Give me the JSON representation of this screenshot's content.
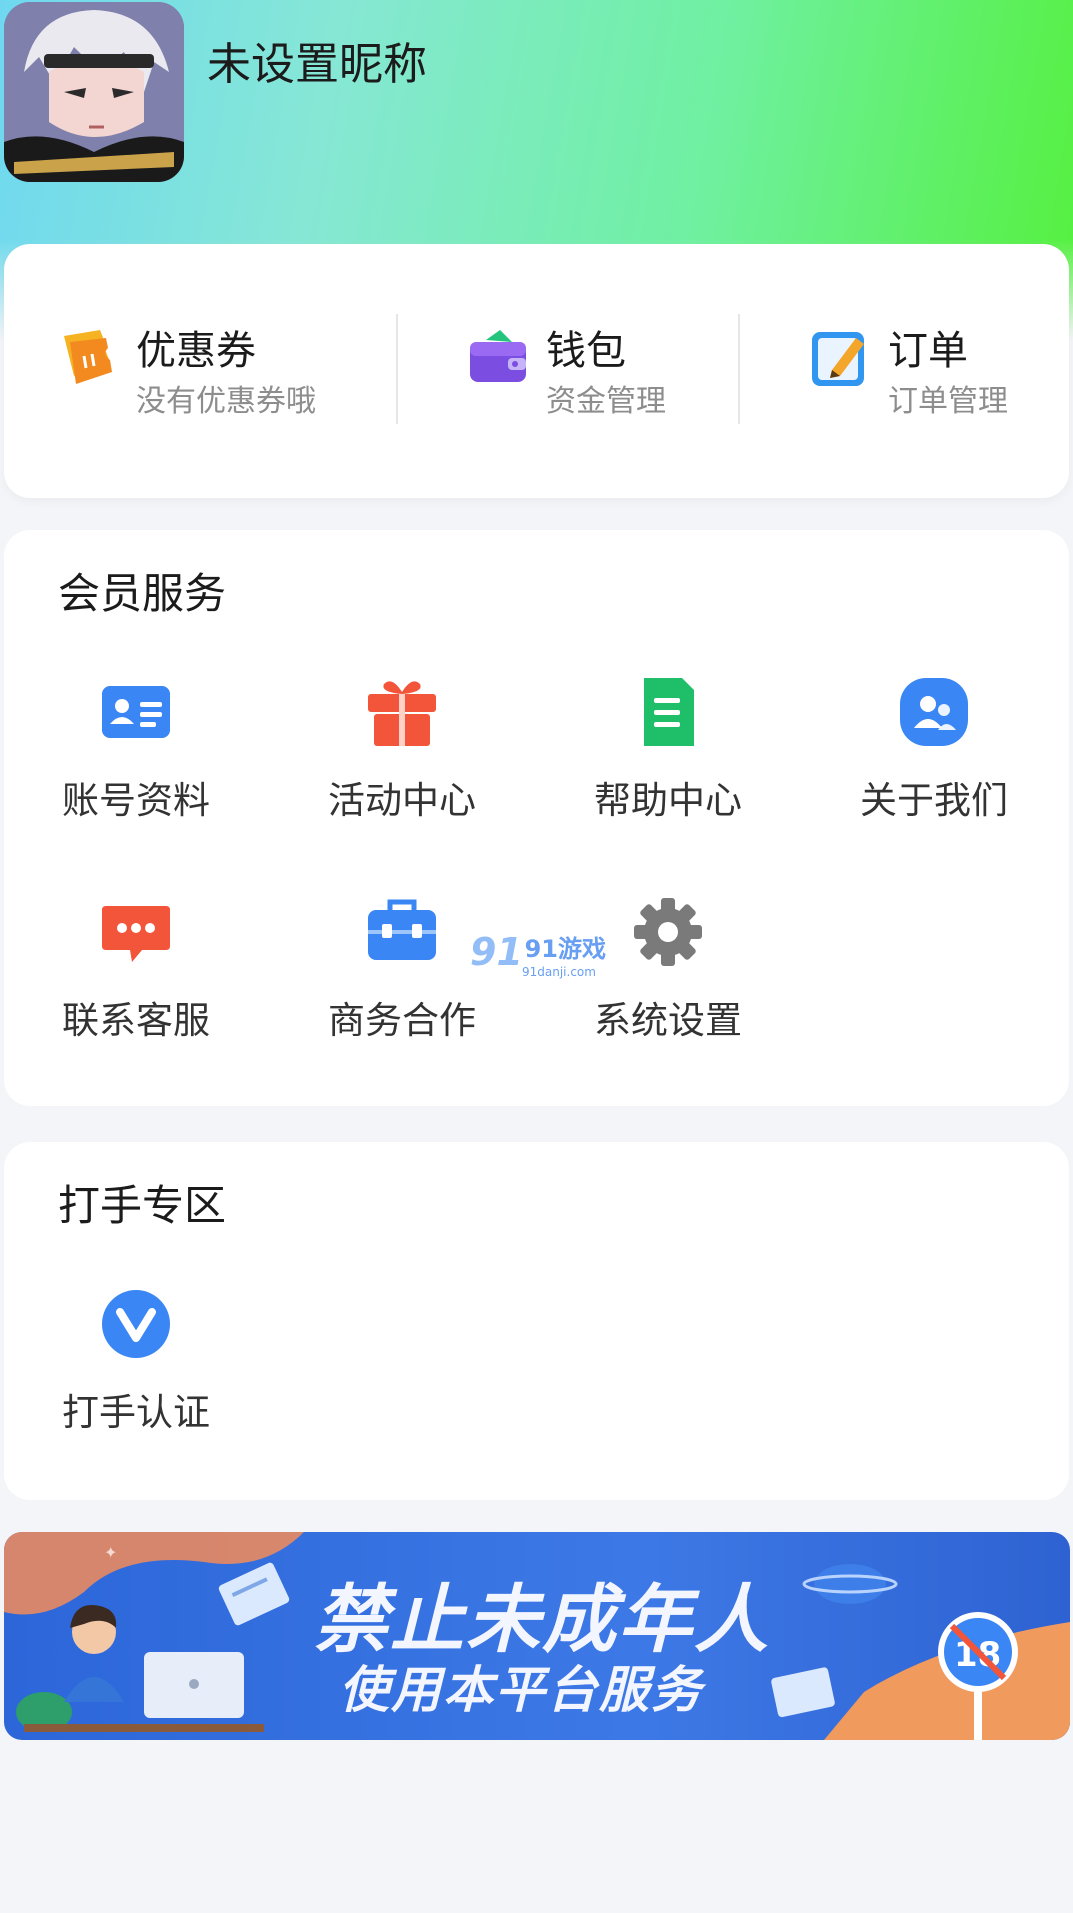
{
  "profile": {
    "nickname": "未设置昵称"
  },
  "quick_links": [
    {
      "title": "优惠券",
      "subtitle": "没有优惠券哦",
      "icon": "coupon-icon"
    },
    {
      "title": "钱包",
      "subtitle": "资金管理",
      "icon": "wallet-icon"
    },
    {
      "title": "订单",
      "subtitle": "订单管理",
      "icon": "order-icon"
    }
  ],
  "member_services": {
    "title": "会员服务",
    "items": [
      {
        "label": "账号资料",
        "icon": "id-card-icon",
        "color": "#3a86f5"
      },
      {
        "label": "活动中心",
        "icon": "gift-icon",
        "color": "#f2553a"
      },
      {
        "label": "帮助中心",
        "icon": "document-icon",
        "color": "#1fbf6a"
      },
      {
        "label": "关于我们",
        "icon": "users-icon",
        "color": "#3a86f5"
      },
      {
        "label": "联系客服",
        "icon": "chat-bubble-icon",
        "color": "#f2553a"
      },
      {
        "label": "商务合作",
        "icon": "briefcase-icon",
        "color": "#3a86f5"
      },
      {
        "label": "系统设置",
        "icon": "gear-icon",
        "color": "#7a7a7a"
      }
    ]
  },
  "player_zone": {
    "title": "打手专区",
    "items": [
      {
        "label": "打手认证",
        "icon": "verified-v-icon",
        "color": "#3a86f5"
      }
    ]
  },
  "watermark": {
    "brand": "91游戏",
    "url": "91danji.com"
  },
  "banner": {
    "line1": "禁止未成年人",
    "line2": "使用本平台服务",
    "badge": "18"
  }
}
